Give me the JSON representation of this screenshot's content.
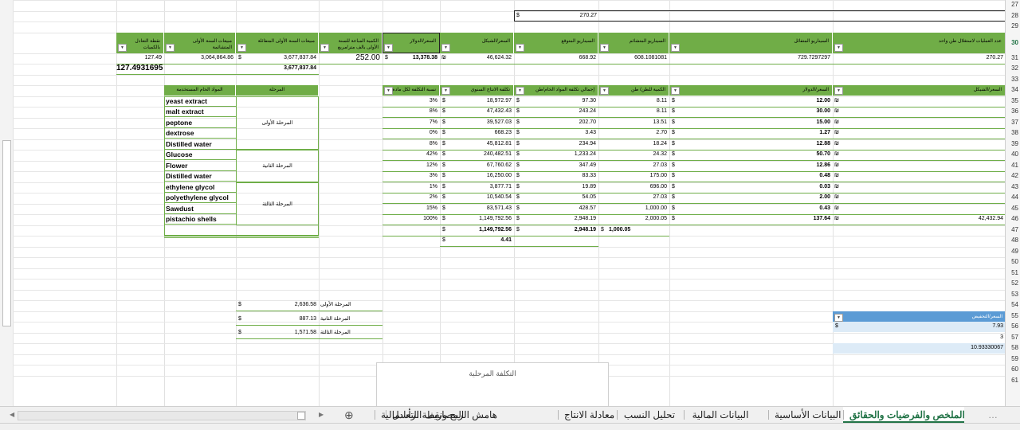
{
  "colors": {
    "header_green": "#70ad47",
    "accent_blue": "#5b9bd5",
    "light_blue": "#ddebf7",
    "active_tab": "#217346"
  },
  "row_numbers": [
    "27",
    "28",
    "29",
    "30",
    "31",
    "32",
    "33",
    "34",
    "35",
    "36",
    "37",
    "38",
    "39",
    "40",
    "41",
    "42",
    "43",
    "44",
    "45",
    "46",
    "47",
    "48",
    "49",
    "50",
    "51",
    "52",
    "53",
    "54",
    "55",
    "56",
    "57",
    "58",
    "59",
    "60",
    "61"
  ],
  "top": {
    "cur": "$",
    "value": "270.27"
  },
  "scenario_headers": [
    "عدد العمليات لاستغلال طن واحد",
    "السيناريو المتفائل",
    "السيناريو المتشائم",
    "السيناريو المتوقع",
    "السعر/الشيكل",
    "السعر/الدولار",
    "الكمية المباعة للسنة الأولى بالف متر/مربع",
    "مبيعات السنة الأولى المتفائلة",
    "مبيعات السنة الأولى المتشائمة",
    "نقطة التعادل بالكميات"
  ],
  "scenario_row": {
    "ops": "270.27",
    "optimistic": "729.7297297",
    "pessimistic": "608.1081081",
    "expected": "668.92",
    "price_ils": "46,624.32",
    "price_usd": "13,378.38",
    "qty": "252.00",
    "opt_sales": "3,677,837.84",
    "pess_sales": "3,064,864.86",
    "breakeven": "127.49"
  },
  "row32": {
    "breakeven_full": "127.4931695",
    "sales": "3,677,837.84"
  },
  "materials_headers": [
    "السعر/الشيكل",
    "السعر/الدولار",
    "الكمية للطن/ طن",
    "إجمالي تكلفة المواد الخام/طن",
    "تكلفة الانتاج السنوي",
    "نسبة التكلفة لكل مادة",
    "المرحلة",
    "المواد الخام المستخدمة"
  ],
  "materials": [
    {
      "name": "yeast extract",
      "pct": "3%",
      "annual": "18,972.97",
      "total": "97.30",
      "qty": "8.11",
      "usd": "12.00"
    },
    {
      "name": "malt extract",
      "pct": "8%",
      "annual": "47,432.43",
      "total": "243.24",
      "qty": "8.11",
      "usd": "30.00"
    },
    {
      "name": "peptone",
      "pct": "7%",
      "annual": "39,527.03",
      "total": "202.70",
      "qty": "13.51",
      "usd": "15.00"
    },
    {
      "name": "dextrose",
      "pct": "0%",
      "annual": "668.23",
      "total": "3.43",
      "qty": "2.70",
      "usd": "1.27"
    },
    {
      "name": "Distilled water",
      "pct": "8%",
      "annual": "45,812.81",
      "total": "234.94",
      "qty": "18.24",
      "usd": "12.88"
    },
    {
      "name": "Glucose",
      "pct": "42%",
      "annual": "240,482.51",
      "total": "1,233.24",
      "qty": "24.32",
      "usd": "50.70"
    },
    {
      "name": " Flower",
      "pct": "12%",
      "annual": "67,760.62",
      "total": "347.49",
      "qty": "27.03",
      "usd": "12.86"
    },
    {
      "name": "Distilled water",
      "pct": "3%",
      "annual": "16,250.00",
      "total": "83.33",
      "qty": "175.00",
      "usd": "0.48"
    },
    {
      "name": " ethylene glycol",
      "pct": "1%",
      "annual": "3,877.71",
      "total": "19.89",
      "qty": "696.00",
      "usd": "0.03"
    },
    {
      "name": "polyethylene glycol",
      "pct": "2%",
      "annual": "10,540.54",
      "total": "54.05",
      "qty": "27.03",
      "usd": "2.00"
    },
    {
      "name": "Sawdust",
      "pct": "15%",
      "annual": "83,571.43",
      "total": "428.57",
      "qty": "1,000.00",
      "usd": "0.43"
    },
    {
      "name": "pistachio shells",
      "pct": "100%",
      "annual": "1,149,792.56",
      "total": "2,948.19",
      "qty": "2,000.05",
      "usd": "137.64",
      "ils": "42,432.94"
    }
  ],
  "stages": [
    "المرحلة الأولى",
    "المرحلة الثانية",
    "المرحلة الثالثة"
  ],
  "currency_ils": "₪",
  "currency_usd": "$",
  "totals": {
    "annual": "1,149,792.56",
    "total": "2,948.19",
    "qty": "1,000.05",
    "extra": "4.41"
  },
  "stage_costs": [
    {
      "label": "المرحلة الأولى",
      "value": "2,636.58"
    },
    {
      "label": "المرحلة الثانية",
      "value": "887.13"
    },
    {
      "label": "المرحلة الثالثة",
      "value": "1,571.58"
    }
  ],
  "discount": {
    "header": "السعر/التخفيض",
    "value": "7.93",
    "count": "3",
    "result": "10.93330067"
  },
  "chart": {
    "title": "التكلفة المرحلية"
  },
  "tabs": [
    "الملخص والفرضيات والحقائق",
    "البيانات الأساسية",
    "البيانات المالية",
    "تحليل النسب",
    "معادلة الانتاج",
    "هامش الربح ونقطة التعادل",
    "المصاريف الرأسمالية"
  ],
  "icons": {
    "add_sheet": "⊕",
    "scroll_left": "◀",
    "scroll_right": "▶",
    "more": "…"
  }
}
